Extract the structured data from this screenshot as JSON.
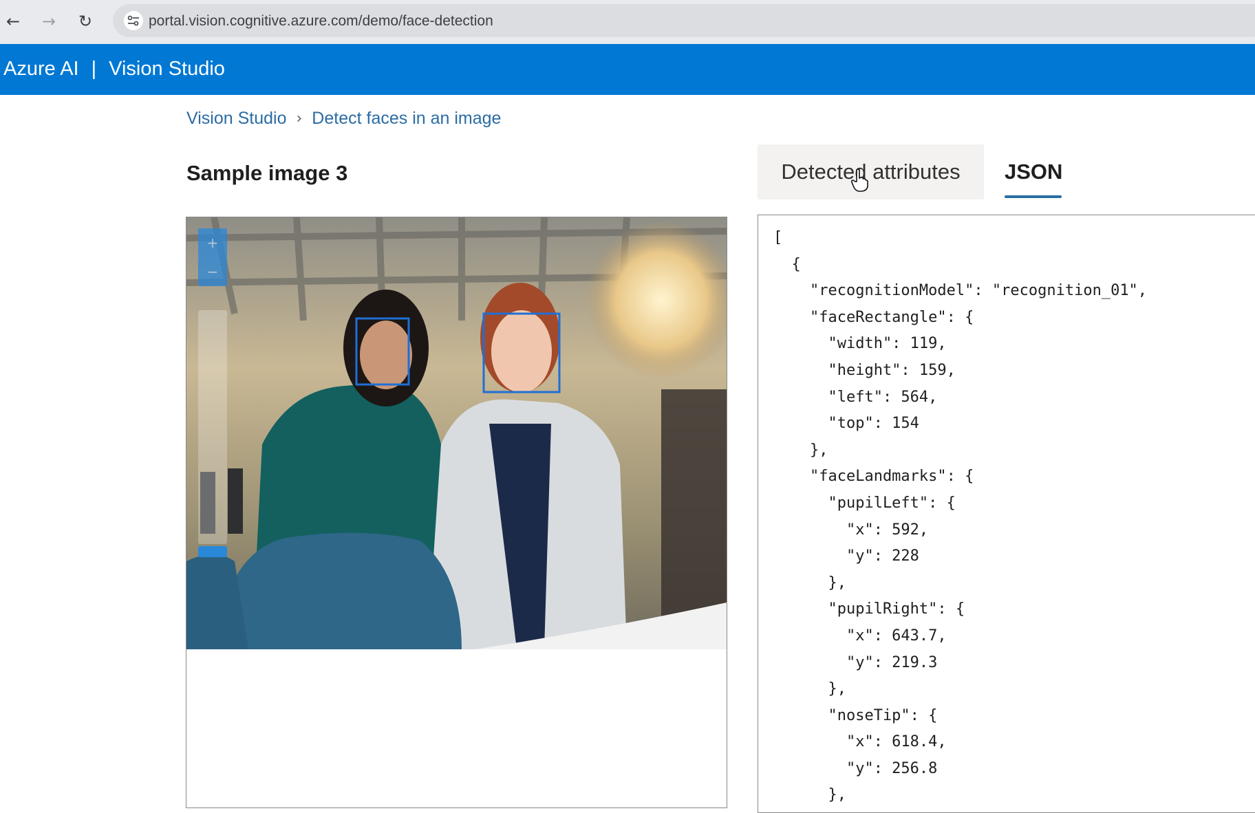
{
  "browser": {
    "back_icon": "←",
    "forward_icon": "→",
    "reload_icon": "↻",
    "url": "portal.vision.cognitive.azure.com/demo/face-detection"
  },
  "header": {
    "brand": "Azure AI",
    "separator": "|",
    "product": "Vision Studio",
    "bg_color": "#0078d4"
  },
  "breadcrumb": {
    "root": "Vision Studio",
    "separator": "›",
    "current": "Detect faces in an image"
  },
  "page_title": "Sample image 3",
  "zoom": {
    "in_label": "+",
    "out_label": "−"
  },
  "tabs": {
    "attributes": "Detected attributes",
    "json": "JSON",
    "active": "JSON"
  },
  "json_lines": [
    "[",
    "  {",
    "    \"recognitionModel\": \"recognition_01\",",
    "    \"faceRectangle\": {",
    "      \"width\": 119,",
    "      \"height\": 159,",
    "      \"left\": 564,",
    "      \"top\": 154",
    "    },",
    "    \"faceLandmarks\": {",
    "      \"pupilLeft\": {",
    "        \"x\": 592,",
    "        \"y\": 228",
    "      },",
    "      \"pupilRight\": {",
    "        \"x\": 643.7,",
    "        \"y\": 219.3",
    "      },",
    "      \"noseTip\": {",
    "        \"x\": 618.4,",
    "        \"y\": 256.8",
    "      },"
  ],
  "face_box_color": "#1f6fd6",
  "icons": [
    "arrow-left-icon",
    "arrow-right-icon",
    "reload-icon",
    "site-settings-icon",
    "chevron-right-icon",
    "hand-cursor-icon"
  ]
}
